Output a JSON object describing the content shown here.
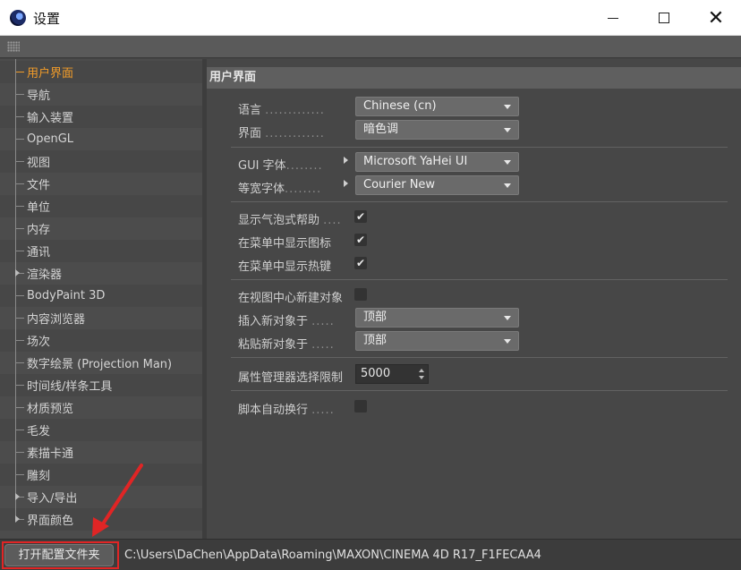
{
  "window": {
    "title": "设置",
    "icon": "cinema4d-icon"
  },
  "sidebar": {
    "items": [
      {
        "label": "用户界面",
        "active": true
      },
      {
        "label": "导航"
      },
      {
        "label": "输入装置"
      },
      {
        "label": "OpenGL"
      },
      {
        "label": "视图"
      },
      {
        "label": "文件"
      },
      {
        "label": "单位"
      },
      {
        "label": "内存"
      },
      {
        "label": "通讯"
      },
      {
        "label": "渲染器",
        "expandable": true
      },
      {
        "label": "BodyPaint 3D"
      },
      {
        "label": "内容浏览器"
      },
      {
        "label": "场次"
      },
      {
        "label": "数字绘景 (Projection Man)"
      },
      {
        "label": "时间线/样条工具"
      },
      {
        "label": "材质预览"
      },
      {
        "label": "毛发"
      },
      {
        "label": "素描卡通"
      },
      {
        "label": "雕刻"
      },
      {
        "label": "导入/导出",
        "expandable": true
      },
      {
        "label": "界面颜色",
        "expandable": true
      }
    ]
  },
  "main": {
    "section_title": "用户界面",
    "language": {
      "label": "语言",
      "value": "Chinese (cn)"
    },
    "theme": {
      "label": "界面",
      "value": "暗色调"
    },
    "gui_font": {
      "label": "GUI 字体",
      "value": "Microsoft YaHei UI"
    },
    "mono_font": {
      "label": "等宽字体",
      "value": "Courier New"
    },
    "bubble_help": {
      "label": "显示气泡式帮助",
      "checked": true
    },
    "menu_icons": {
      "label": "在菜单中显示图标",
      "checked": true
    },
    "menu_hotkeys": {
      "label": "在菜单中显示热键",
      "checked": true
    },
    "new_obj_center": {
      "label": "在视图中心新建对象",
      "checked": false
    },
    "insert_new": {
      "label": "插入新对象于",
      "value": "顶部"
    },
    "paste_new": {
      "label": "粘贴新对象于",
      "value": "顶部"
    },
    "attr_limit": {
      "label": "属性管理器选择限制",
      "value": "5000"
    },
    "script_wrap": {
      "label": "脚本自动换行",
      "checked": false
    }
  },
  "footer": {
    "open_folder_label": "打开配置文件夹",
    "path": "C:\\Users\\DaChen\\AppData\\Roaming\\MAXON\\CINEMA 4D R17_F1FECAA4"
  },
  "colors": {
    "active": "#f29c29",
    "highlight": "#e02525"
  }
}
